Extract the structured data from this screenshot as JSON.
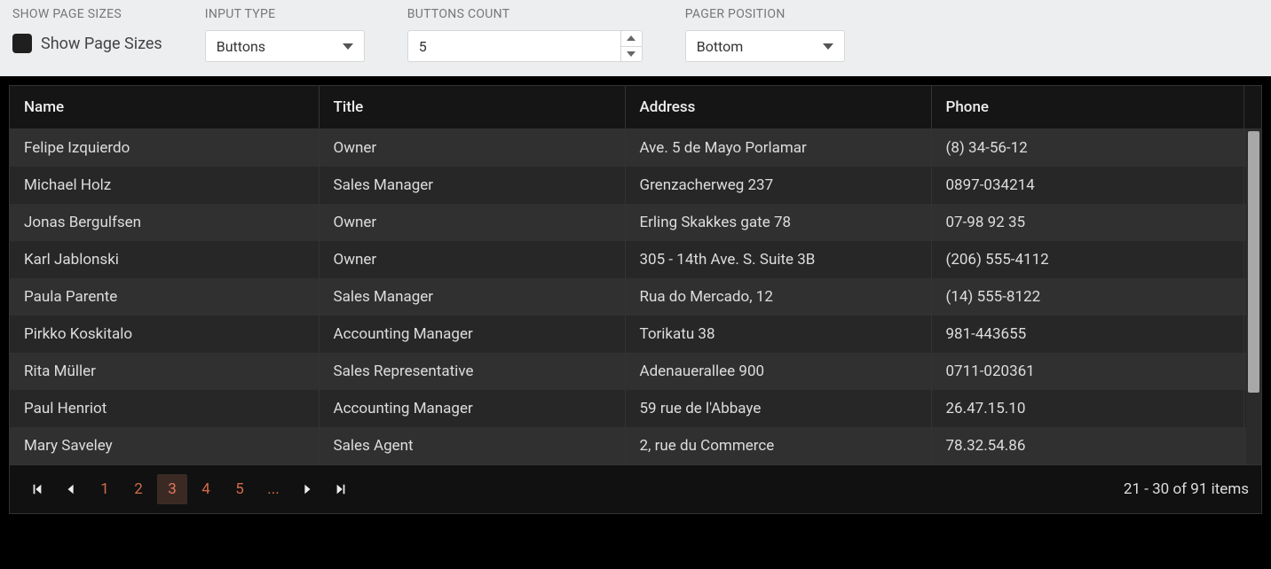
{
  "toolbar": {
    "showPageSizes": {
      "label": "SHOW PAGE SIZES",
      "checkboxLabel": "Show Page Sizes",
      "checked": false
    },
    "inputType": {
      "label": "INPUT TYPE",
      "value": "Buttons"
    },
    "buttonsCount": {
      "label": "BUTTONS COUNT",
      "value": "5"
    },
    "pagerPosition": {
      "label": "PAGER POSITION",
      "value": "Bottom"
    }
  },
  "grid": {
    "columns": [
      "Name",
      "Title",
      "Address",
      "Phone"
    ],
    "rows": [
      {
        "name": "Felipe Izquierdo",
        "title": "Owner",
        "address": "Ave. 5 de Mayo Porlamar",
        "phone": "(8) 34-56-12"
      },
      {
        "name": "Michael Holz",
        "title": "Sales Manager",
        "address": "Grenzacherweg 237",
        "phone": "0897-034214"
      },
      {
        "name": "Jonas Bergulfsen",
        "title": "Owner",
        "address": "Erling Skakkes gate 78",
        "phone": "07-98 92 35"
      },
      {
        "name": "Karl Jablonski",
        "title": "Owner",
        "address": "305 - 14th Ave. S. Suite 3B",
        "phone": "(206) 555-4112"
      },
      {
        "name": "Paula Parente",
        "title": "Sales Manager",
        "address": "Rua do Mercado, 12",
        "phone": "(14) 555-8122"
      },
      {
        "name": "Pirkko Koskitalo",
        "title": "Accounting Manager",
        "address": "Torikatu 38",
        "phone": "981-443655"
      },
      {
        "name": "Rita Müller",
        "title": "Sales Representative",
        "address": "Adenauerallee 900",
        "phone": "0711-020361"
      },
      {
        "name": "Paul Henriot",
        "title": "Accounting Manager",
        "address": "59 rue de l'Abbaye",
        "phone": "26.47.15.10"
      },
      {
        "name": "Mary Saveley",
        "title": "Sales Agent",
        "address": "2, rue du Commerce",
        "phone": "78.32.54.86"
      }
    ]
  },
  "pager": {
    "pages": [
      "1",
      "2",
      "3",
      "4",
      "5"
    ],
    "ellipsis": "...",
    "current": "3",
    "info": "21 - 30 of 91 items"
  }
}
